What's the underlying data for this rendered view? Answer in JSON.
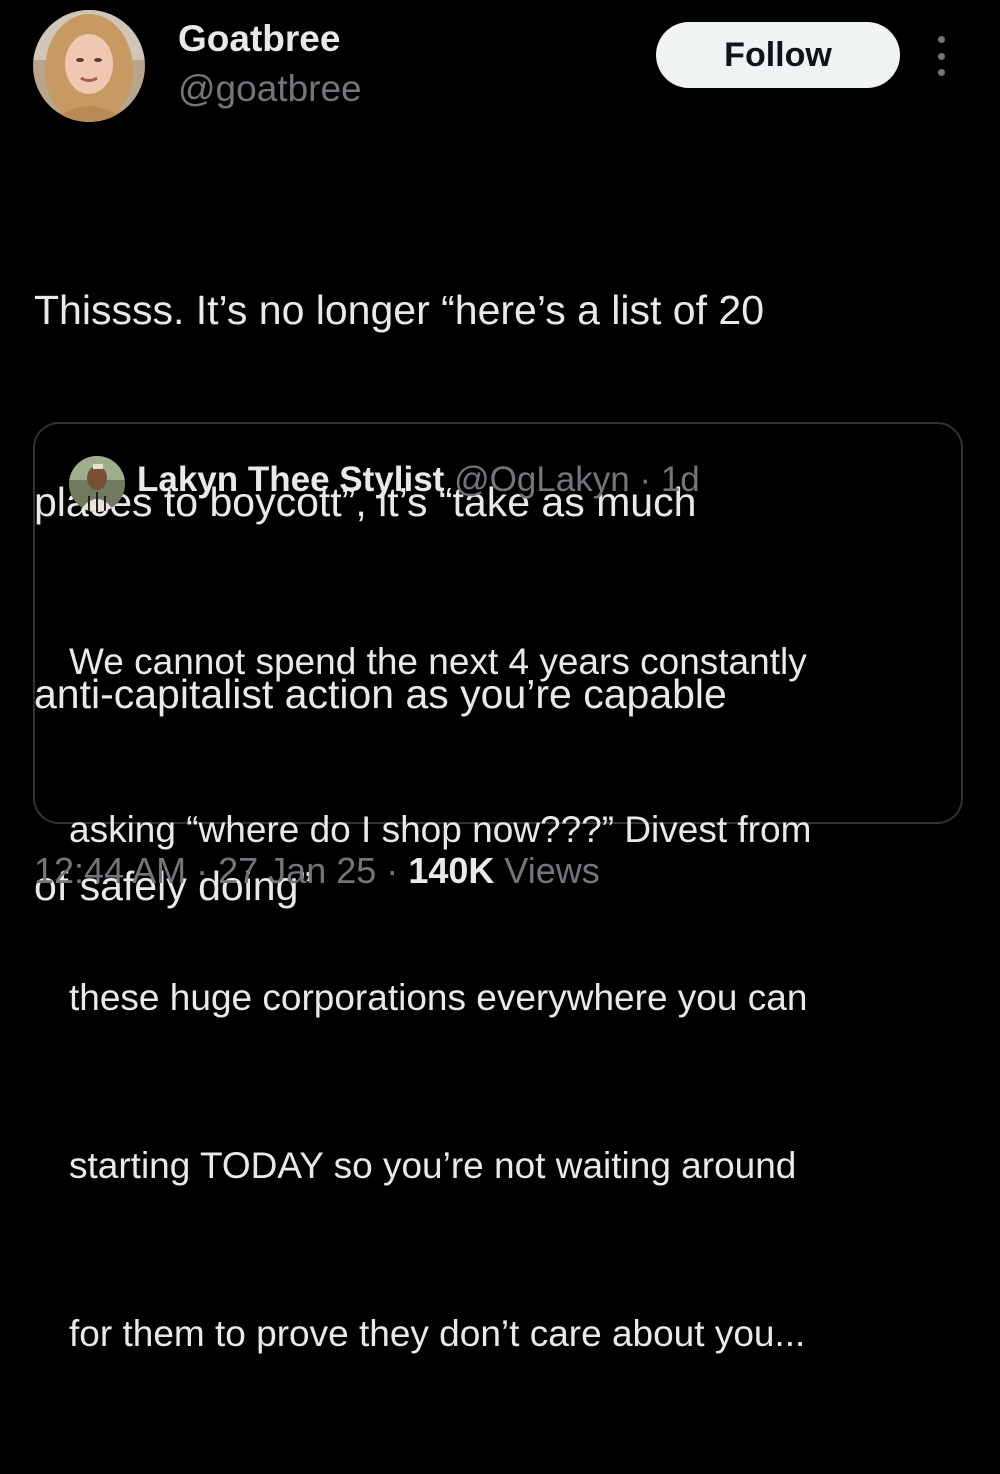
{
  "tweet": {
    "author": {
      "name": "Goatbree",
      "handle": "@goatbree"
    },
    "follow_label": "Follow",
    "more_icon": "more-dots-icon",
    "text_lines": [
      "Thissss. It’s no longer “here’s a list of 20",
      "places to boycott”, it’s “take as much",
      "anti-capitalist action as you’re capable",
      "of safely doing”"
    ],
    "quote": {
      "name": "Lakyn Thee Stylist",
      "handle": "@OgLakyn",
      "separator": "·",
      "time": "1d",
      "text_lines": [
        "We cannot spend the next 4 years constantly",
        "asking “where do I shop now???” Divest from",
        "these huge corporations everywhere you can",
        "starting TODAY so you’re not waiting around",
        "for them to prove they don’t care about you..."
      ]
    },
    "meta": {
      "time": "12:44 AM",
      "sep1": "·",
      "date": "27 Jan 25",
      "sep2": "·",
      "views_count": "140K",
      "views_label": "Views"
    }
  },
  "colors": {
    "background": "#000000",
    "text_primary": "#e7e9ea",
    "text_secondary": "#71767b",
    "border": "#2f3336",
    "follow_bg": "#eff3f4",
    "follow_text": "#0f1419"
  }
}
